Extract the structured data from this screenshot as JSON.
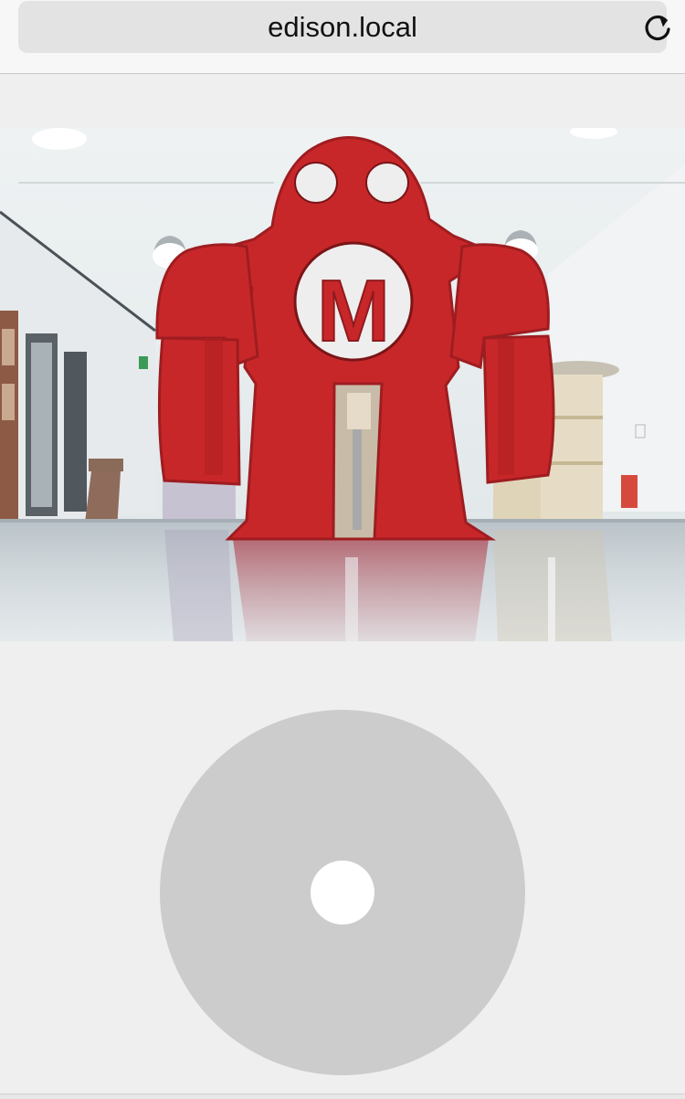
{
  "browser": {
    "url": "edison.local",
    "reload_icon": "reload-icon"
  },
  "camera_feed": {
    "logo_letter": "M"
  },
  "joystick": {
    "base_color": "#cccccc",
    "knob_color": "#ffffff"
  },
  "colors": {
    "robot_red": "#c8272a",
    "page_background": "#efefef"
  }
}
